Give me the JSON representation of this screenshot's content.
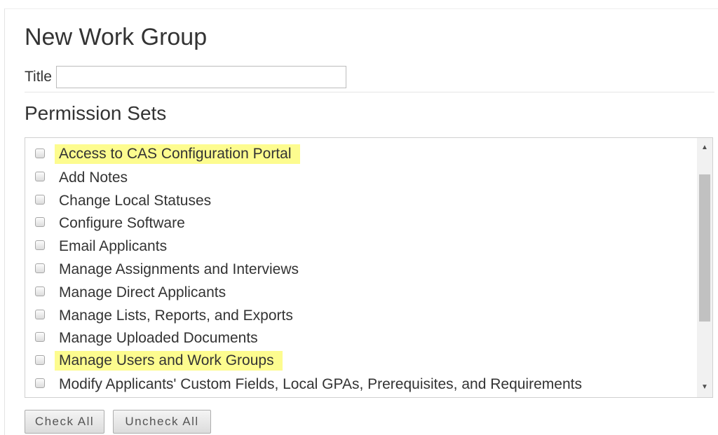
{
  "form": {
    "heading": "New Work Group",
    "title_label": "Title",
    "title_value": "",
    "title_placeholder": ""
  },
  "permissions": {
    "heading": "Permission Sets",
    "items": [
      {
        "label": "Access to CAS Configuration Portal",
        "checked": false,
        "highlighted": true
      },
      {
        "label": "Add Notes",
        "checked": false,
        "highlighted": false
      },
      {
        "label": "Change Local Statuses",
        "checked": false,
        "highlighted": false
      },
      {
        "label": "Configure Software",
        "checked": false,
        "highlighted": false
      },
      {
        "label": "Email Applicants",
        "checked": false,
        "highlighted": false
      },
      {
        "label": "Manage Assignments and Interviews",
        "checked": false,
        "highlighted": false
      },
      {
        "label": "Manage Direct Applicants",
        "checked": false,
        "highlighted": false
      },
      {
        "label": "Manage Lists, Reports, and Exports",
        "checked": false,
        "highlighted": false
      },
      {
        "label": "Manage Uploaded Documents",
        "checked": false,
        "highlighted": false
      },
      {
        "label": "Manage Users and Work Groups",
        "checked": false,
        "highlighted": true
      },
      {
        "label": "Modify Applicants' Custom Fields, Local GPAs, Prerequisites, and Requirements",
        "checked": false,
        "highlighted": false
      }
    ],
    "highlight_color": "#fdfc8f"
  },
  "buttons": {
    "check_all": "Check All",
    "uncheck_all": "Uncheck All"
  },
  "icons": {
    "scroll_up": "scroll-up-arrow-icon",
    "scroll_down": "scroll-down-arrow-icon"
  }
}
